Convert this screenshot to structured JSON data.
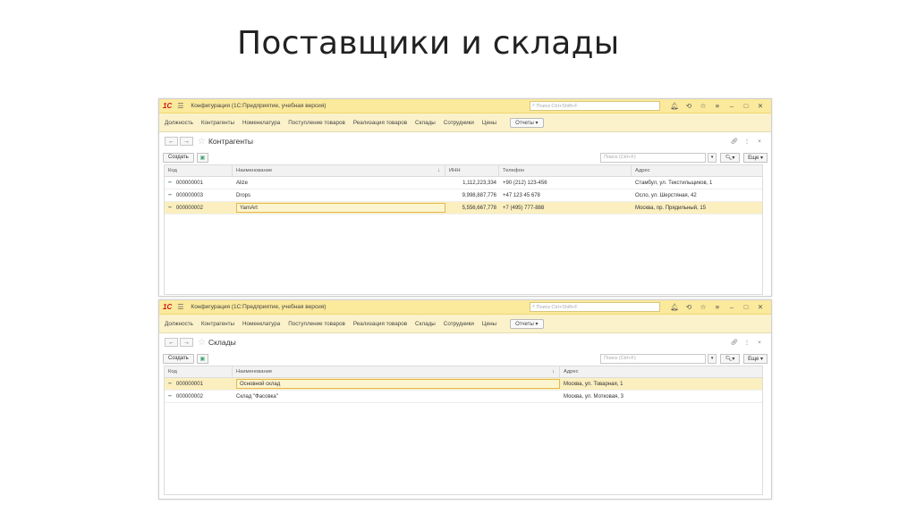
{
  "slide": {
    "title": "Поставщики и склады"
  },
  "colors": {
    "titlebar": "#fbe99c",
    "menubar": "#fbf2cb",
    "selected_row": "#fbefc0",
    "brand": "#d2141a"
  },
  "window1": {
    "logo": "1С",
    "title": "Конфигурация (1С:Предприятие, учебная версия)",
    "search_placeholder": "Поиск Ctrl+Shift+F",
    "menu": [
      "Должность",
      "Контрагенты",
      "Номенклатура",
      "Поступление товаров",
      "Реализация товаров",
      "Склады",
      "Сотрудники",
      "Цены"
    ],
    "reports_label": "Отчеты ▾",
    "form_title": "Контрагенты",
    "create_label": "Создать",
    "list_search_placeholder": "Поиск (Ctrl+F)",
    "more_label": "Еще ▾",
    "columns": [
      "Код",
      "Наименование",
      "ИНН",
      "Телефон",
      "Адрес"
    ],
    "rows": [
      {
        "code": "000000001",
        "name": "Alize",
        "inn": "1,112,223,334",
        "phone": "+90 (212) 123-456",
        "address": "Стамбул, ул. Текстильщиков, 1"
      },
      {
        "code": "000000003",
        "name": "Drops",
        "inn": "9,998,887,776",
        "phone": "+47 123 45 678",
        "address": "Осло, ул. Шерстяная, 42"
      },
      {
        "code": "000000002",
        "name": "YarnArt",
        "inn": "5,556,667,778",
        "phone": "+7 (495) 777-888",
        "address": "Москва, пр. Прядильный, 15"
      }
    ]
  },
  "window2": {
    "logo": "1С",
    "title": "Конфигурация (1С:Предприятие, учебная версия)",
    "search_placeholder": "Поиск Ctrl+Shift+F",
    "menu": [
      "Должность",
      "Контрагенты",
      "Номенклатура",
      "Поступление товаров",
      "Реализация товаров",
      "Склады",
      "Сотрудники",
      "Цены"
    ],
    "reports_label": "Отчеты ▾",
    "form_title": "Склады",
    "create_label": "Создать",
    "list_search_placeholder": "Поиск (Ctrl+F)",
    "more_label": "Еще ▾",
    "columns": [
      "Код",
      "Наименование",
      "Адрес"
    ],
    "rows": [
      {
        "code": "000000001",
        "name": "Основной склад",
        "address": "Москва, ул. Товарная, 1"
      },
      {
        "code": "000000002",
        "name": "Склад \"Фасовка\"",
        "address": "Москва, ул. Мотковая, 3"
      }
    ]
  }
}
